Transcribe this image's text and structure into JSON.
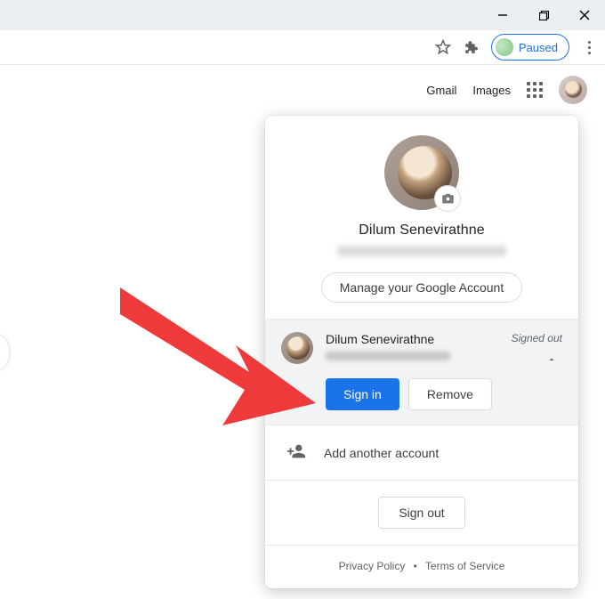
{
  "window": {
    "minimize": "−",
    "maximize": "❐",
    "close": "✕"
  },
  "toolbar": {
    "paused_label": "Paused"
  },
  "gheader": {
    "gmail": "Gmail",
    "images": "Images"
  },
  "panel": {
    "name": "Dilum Senevirathne",
    "manage": "Manage your Google Account",
    "account": {
      "name": "Dilum Senevirathne",
      "status": "Signed out",
      "sign_in": "Sign in",
      "remove": "Remove"
    },
    "add_another": "Add another account",
    "sign_out": "Sign out",
    "privacy": "Privacy Policy",
    "dot": "•",
    "terms": "Terms of Service"
  }
}
